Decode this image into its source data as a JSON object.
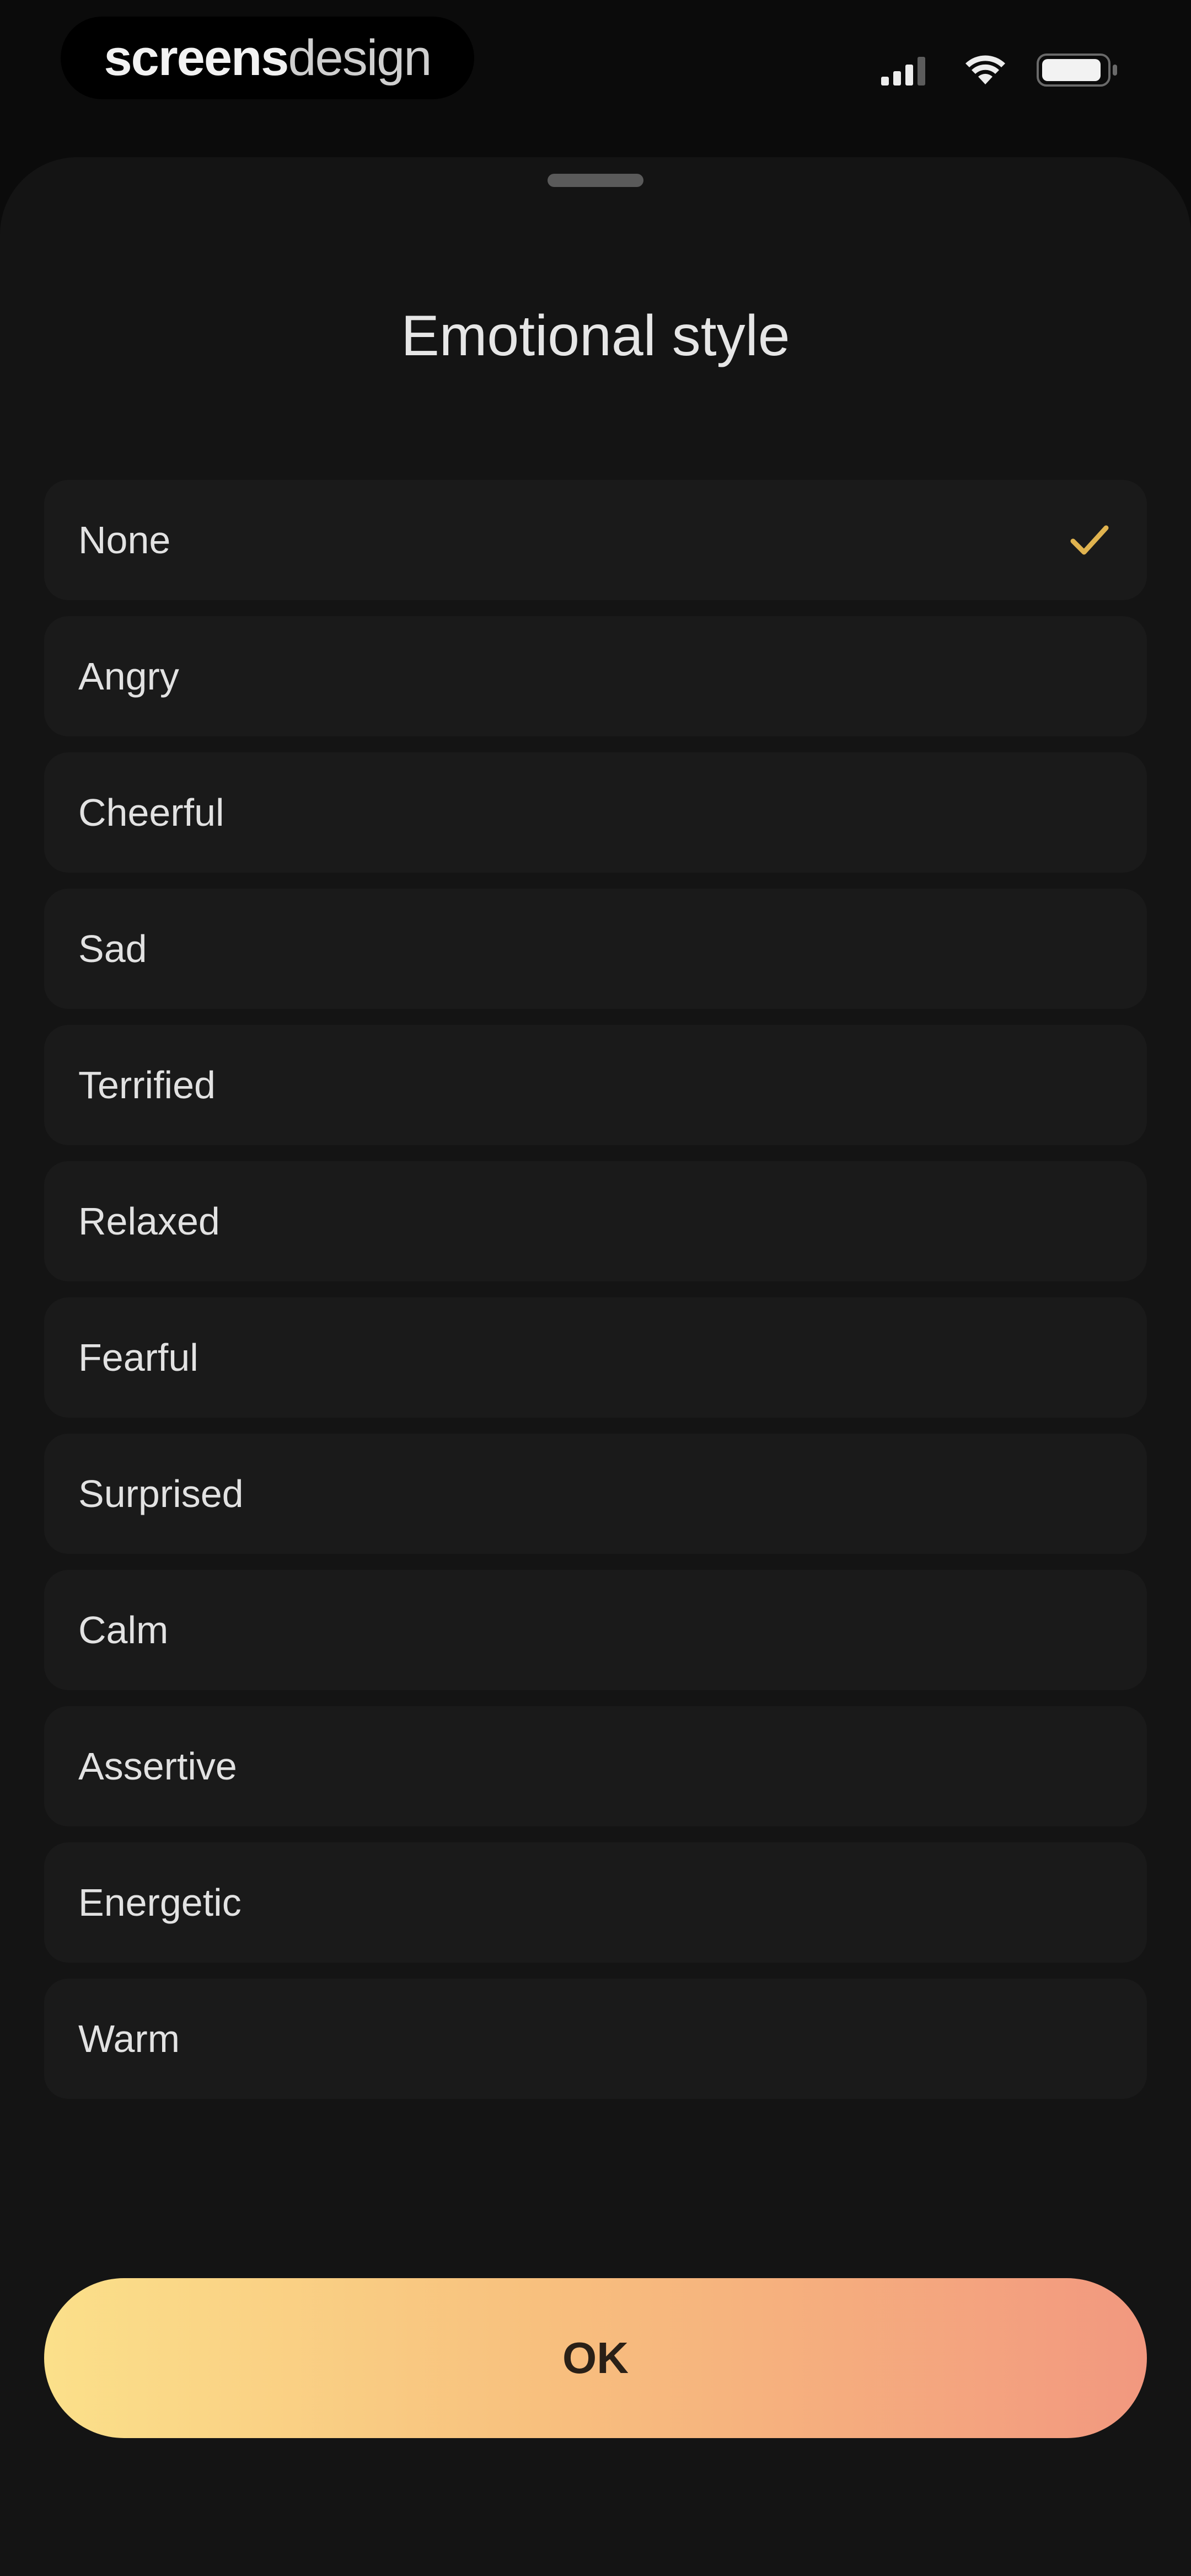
{
  "status_bar": {
    "brand_bold": "screens",
    "brand_light": "design",
    "signal_icon": "cellular-signal-icon",
    "wifi_icon": "wifi-icon",
    "battery_icon": "battery-icon"
  },
  "sheet": {
    "title": "Emotional style",
    "selected_index": 0,
    "accent_color": "#e0b34f",
    "options": [
      {
        "label": "None",
        "selected": true
      },
      {
        "label": "Angry",
        "selected": false
      },
      {
        "label": "Cheerful",
        "selected": false
      },
      {
        "label": "Sad",
        "selected": false
      },
      {
        "label": "Terrified",
        "selected": false
      },
      {
        "label": "Relaxed",
        "selected": false
      },
      {
        "label": "Fearful",
        "selected": false
      },
      {
        "label": "Surprised",
        "selected": false
      },
      {
        "label": "Calm",
        "selected": false
      },
      {
        "label": "Assertive",
        "selected": false
      },
      {
        "label": "Energetic",
        "selected": false
      },
      {
        "label": "Warm",
        "selected": false
      }
    ]
  },
  "ok_button": {
    "label": "OK",
    "gradient": [
      "#fbe08a",
      "#f2987f"
    ]
  }
}
